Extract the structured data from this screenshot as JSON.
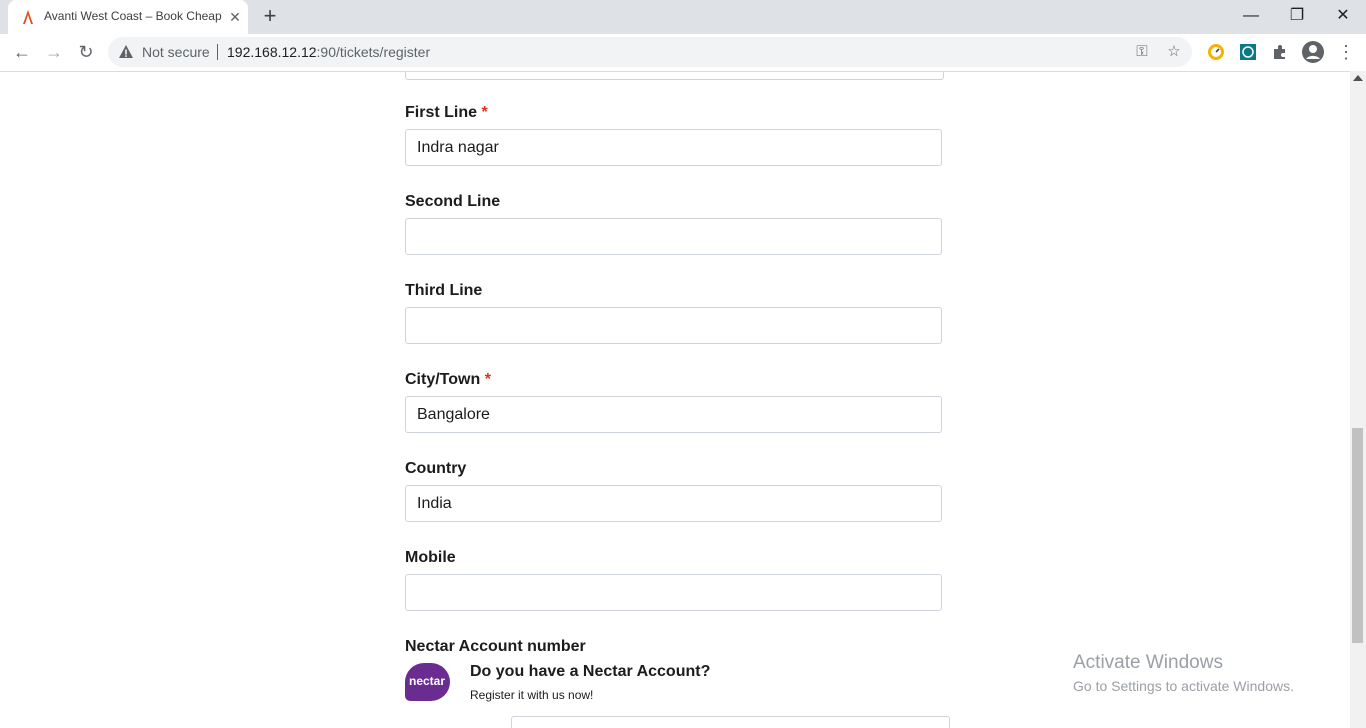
{
  "browser": {
    "tab_title": "Avanti West Coast – Book Cheap",
    "new_tab_symbol": "+",
    "security_label": "Not secure",
    "url_host": "192.168.12.12",
    "url_path": ":90/tickets/register"
  },
  "form": {
    "first_line": {
      "label": "First Line",
      "required": "*",
      "value": "Indra nagar"
    },
    "second_line": {
      "label": "Second Line",
      "value": ""
    },
    "third_line": {
      "label": "Third Line",
      "value": ""
    },
    "city": {
      "label": "City/Town",
      "required": "*",
      "value": "Bangalore"
    },
    "country": {
      "label": "Country",
      "value": "India"
    },
    "mobile": {
      "label": "Mobile",
      "value": ""
    },
    "nectar": {
      "label": "Nectar Account number",
      "logo_text": "nectar",
      "title": "Do you have a Nectar Account?",
      "subtitle": "Register it with us now!"
    }
  },
  "watermark": {
    "line1": "Activate Windows",
    "line2": "Go to Settings to activate Windows."
  },
  "colors": {
    "required": "#e0301e",
    "nectar_purple": "#6a2c91"
  }
}
